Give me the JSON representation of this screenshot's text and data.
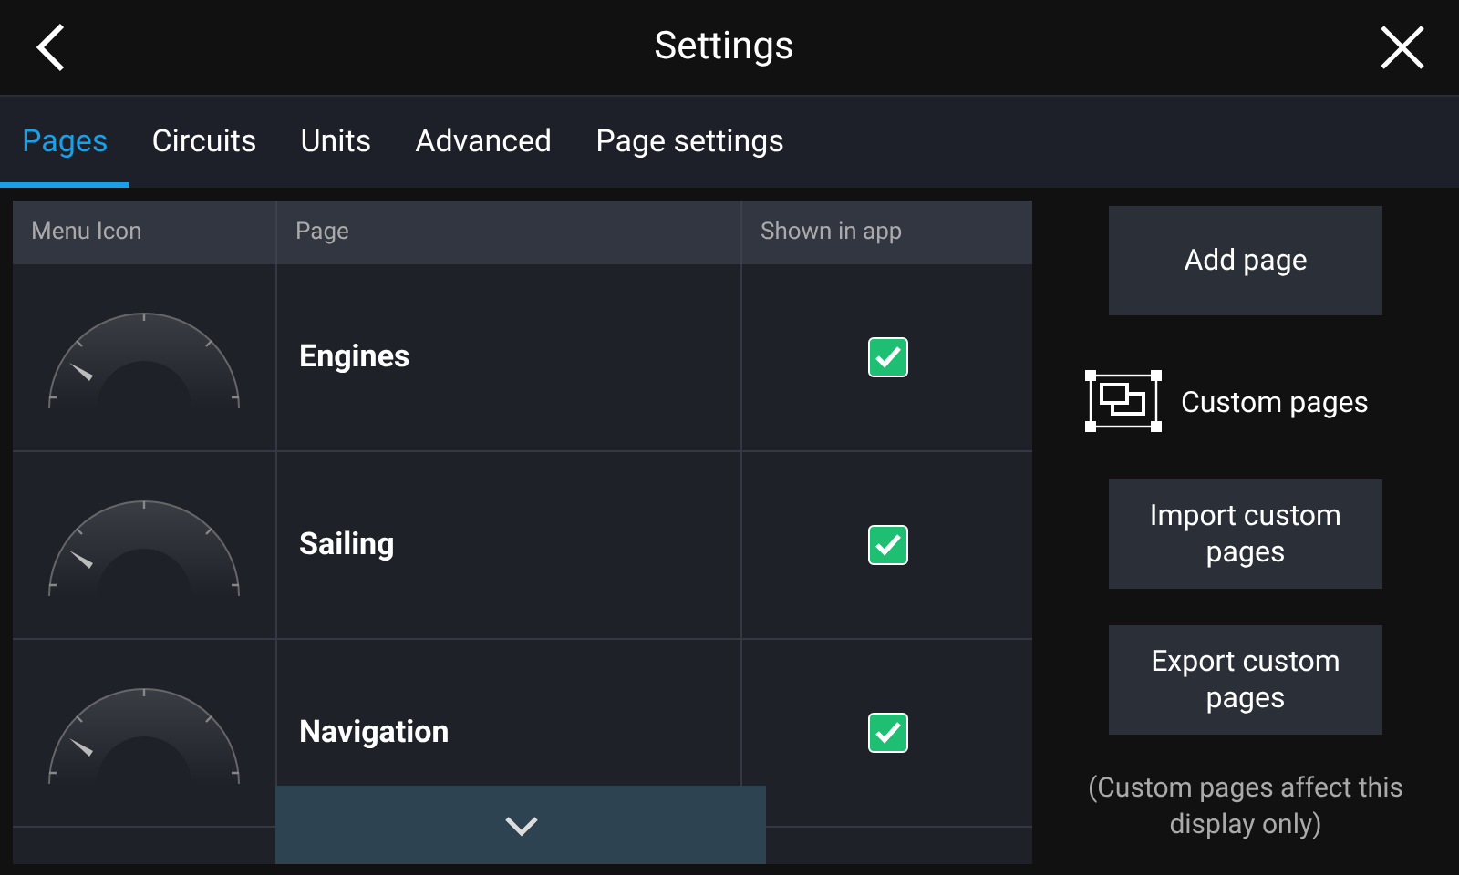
{
  "header": {
    "title": "Settings"
  },
  "tabs": [
    {
      "label": "Pages",
      "selected": true
    },
    {
      "label": "Circuits",
      "selected": false
    },
    {
      "label": "Units",
      "selected": false
    },
    {
      "label": "Advanced",
      "selected": false
    },
    {
      "label": "Page settings",
      "selected": false
    }
  ],
  "table": {
    "columns": [
      "Menu Icon",
      "Page",
      "Shown in app"
    ],
    "rows": [
      {
        "page": "Engines",
        "shown": true
      },
      {
        "page": "Sailing",
        "shown": true
      },
      {
        "page": "Navigation",
        "shown": true
      }
    ]
  },
  "actions": {
    "add_page": "Add page",
    "custom_pages_label": "Custom pages",
    "import": "Import custom pages",
    "export": "Export custom pages",
    "note": "(Custom pages affect this display only)"
  }
}
